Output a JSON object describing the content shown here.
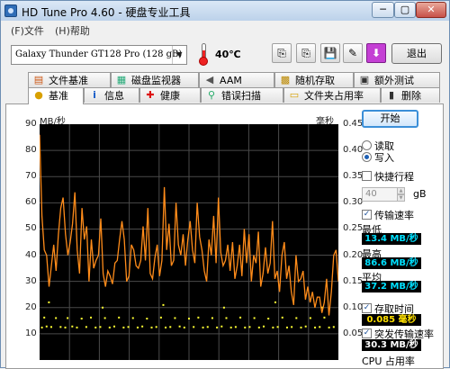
{
  "window": {
    "title": "HD Tune Pro 4.60 - 硬盘专业工具",
    "min_label": "─",
    "max_label": "▢",
    "close_label": "✕"
  },
  "menu": [
    {
      "label": "(F)文件"
    },
    {
      "label": "(H)帮助"
    }
  ],
  "toolbar": {
    "drive": "Galaxy Thunder GT128 Pro (128 gB)",
    "temperature": "40℃",
    "buttons": [
      {
        "icon": "copy-icon",
        "glyph": "⎘"
      },
      {
        "icon": "copy-green-icon",
        "glyph": "⎘"
      },
      {
        "icon": "save-icon",
        "glyph": "💾"
      },
      {
        "icon": "tools-icon",
        "glyph": "✎"
      },
      {
        "icon": "download-icon",
        "glyph": "⬇"
      }
    ],
    "exit_label": "退出"
  },
  "tabs_top": [
    {
      "label": "文件基准",
      "icon": "file-benchmark-icon",
      "glyph": "▤"
    },
    {
      "label": "磁盘监视器",
      "icon": "disk-monitor-icon",
      "glyph": "▦"
    },
    {
      "label": "AAM",
      "icon": "speaker-icon",
      "glyph": "◀"
    },
    {
      "label": "随机存取",
      "icon": "random-access-icon",
      "glyph": "▩"
    },
    {
      "label": "额外测试",
      "icon": "extra-test-icon",
      "glyph": "▣"
    }
  ],
  "tabs_bottom": [
    {
      "label": "基准",
      "icon": "benchmark-icon",
      "glyph": "●",
      "active": true
    },
    {
      "label": "信息",
      "icon": "info-icon",
      "glyph": "i",
      "active": false
    },
    {
      "label": "健康",
      "icon": "health-icon",
      "glyph": "✚",
      "active": false
    },
    {
      "label": "错误扫描",
      "icon": "error-scan-icon",
      "glyph": "⚲",
      "active": false
    },
    {
      "label": "文件夹占用率",
      "icon": "folder-icon",
      "glyph": "▭",
      "active": false
    },
    {
      "label": "删除",
      "icon": "delete-icon",
      "glyph": "▮",
      "active": false
    }
  ],
  "side": {
    "start_label": "开始",
    "read_label": "读取",
    "write_label": "写入",
    "mode_selected": "写入",
    "short_stroke_label": "快捷行程",
    "short_stroke_checked": false,
    "short_stroke_value": "40",
    "short_stroke_unit": "gB",
    "transfer_rate_label": "传输速率",
    "transfer_rate_checked": true,
    "min_label": "最低",
    "min_value": "13.4 MB/秒",
    "max_label": "最高",
    "max_value": "86.6 MB/秒",
    "avg_label": "平均",
    "avg_value": "37.2 MB/秒",
    "access_time_label": "存取时间",
    "access_time_checked": true,
    "access_time_value": "0.085 毫秒",
    "burst_rate_label": "突发传输速率",
    "burst_rate_checked": true,
    "burst_rate_value": "30.3 MB/秒",
    "cpu_label": "CPU 占用率"
  },
  "colors": {
    "transfer_line": "#ff8c1a",
    "access_dots": "#ffff33",
    "grid": "#4a4a4a"
  },
  "chart_data": {
    "type": "line",
    "yunit_left": "MB/秒",
    "yunit_right": "毫秒",
    "yticks_left": [
      "90",
      "80",
      "70",
      "60",
      "50",
      "40",
      "30",
      "20",
      "10"
    ],
    "yticks_right": [
      "0.45",
      "0.40",
      "0.35",
      "0.30",
      "0.25",
      "0.20",
      "0.15",
      "0.10",
      "0.05"
    ],
    "ylim_left": [
      0,
      90
    ],
    "ylim_right": [
      0,
      0.45
    ],
    "xlim": [
      0,
      128
    ],
    "grid": true,
    "series": [
      {
        "name": "传输速率",
        "values": [
          86,
          55,
          42,
          40,
          28,
          36,
          44,
          34,
          48,
          58,
          62,
          48,
          40,
          45,
          52,
          64,
          42,
          33,
          58,
          46,
          51,
          30,
          46,
          35,
          38,
          40,
          54,
          33,
          28,
          34,
          32,
          29,
          37,
          38,
          46,
          53,
          46,
          30,
          32,
          44,
          42,
          36,
          35,
          38,
          51,
          38,
          58,
          33,
          31,
          39,
          44,
          32,
          38,
          66,
          42,
          52,
          36,
          38,
          60,
          44,
          40,
          48,
          36,
          46,
          53,
          42,
          37,
          60,
          47,
          42,
          34,
          30,
          46,
          40,
          55,
          37,
          62,
          41,
          36,
          38,
          44,
          34,
          45,
          31,
          36,
          44,
          32,
          50,
          37,
          48,
          30,
          40,
          37,
          49,
          28,
          33,
          43,
          33,
          37,
          53,
          31,
          34,
          26,
          40,
          45,
          31,
          36,
          26,
          21,
          40,
          30,
          31,
          34,
          23,
          28,
          22,
          26,
          20,
          24,
          24,
          18,
          22,
          31,
          17,
          26,
          40,
          42,
          30
        ]
      },
      {
        "name": "存取时间",
        "points": [
          [
            1,
            0.062
          ],
          [
            2,
            0.081
          ],
          [
            3,
            0.064
          ],
          [
            5,
            0.063
          ],
          [
            7,
            0.08
          ],
          [
            9,
            0.063
          ],
          [
            11,
            0.062
          ],
          [
            12,
            0.08
          ],
          [
            14,
            0.064
          ],
          [
            16,
            0.062
          ],
          [
            18,
            0.079
          ],
          [
            20,
            0.063
          ],
          [
            22,
            0.081
          ],
          [
            24,
            0.062
          ],
          [
            26,
            0.063
          ],
          [
            28,
            0.08
          ],
          [
            30,
            0.062
          ],
          [
            32,
            0.064
          ],
          [
            34,
            0.081
          ],
          [
            36,
            0.062
          ],
          [
            38,
            0.063
          ],
          [
            40,
            0.08
          ],
          [
            42,
            0.062
          ],
          [
            44,
            0.064
          ],
          [
            46,
            0.079
          ],
          [
            48,
            0.062
          ],
          [
            50,
            0.063
          ],
          [
            52,
            0.081
          ],
          [
            54,
            0.062
          ],
          [
            56,
            0.063
          ],
          [
            58,
            0.08
          ],
          [
            60,
            0.064
          ],
          [
            62,
            0.062
          ],
          [
            64,
            0.079
          ],
          [
            66,
            0.063
          ],
          [
            68,
            0.081
          ],
          [
            70,
            0.062
          ],
          [
            72,
            0.063
          ],
          [
            74,
            0.08
          ],
          [
            76,
            0.062
          ],
          [
            78,
            0.064
          ],
          [
            80,
            0.08
          ],
          [
            82,
            0.062
          ],
          [
            84,
            0.063
          ],
          [
            86,
            0.081
          ],
          [
            88,
            0.062
          ],
          [
            90,
            0.063
          ],
          [
            92,
            0.08
          ],
          [
            94,
            0.062
          ],
          [
            96,
            0.064
          ],
          [
            98,
            0.079
          ],
          [
            100,
            0.062
          ],
          [
            102,
            0.063
          ],
          [
            104,
            0.081
          ],
          [
            106,
            0.062
          ],
          [
            108,
            0.063
          ],
          [
            110,
            0.08
          ],
          [
            112,
            0.062
          ],
          [
            114,
            0.064
          ],
          [
            116,
            0.08
          ],
          [
            118,
            0.062
          ],
          [
            120,
            0.063
          ],
          [
            122,
            0.081
          ],
          [
            124,
            0.062
          ],
          [
            126,
            0.063
          ],
          [
            4,
            0.11
          ],
          [
            27,
            0.1
          ],
          [
            53,
            0.105
          ],
          [
            79,
            0.1
          ],
          [
            101,
            0.11
          ],
          [
            121,
            0.1
          ]
        ]
      }
    ]
  }
}
